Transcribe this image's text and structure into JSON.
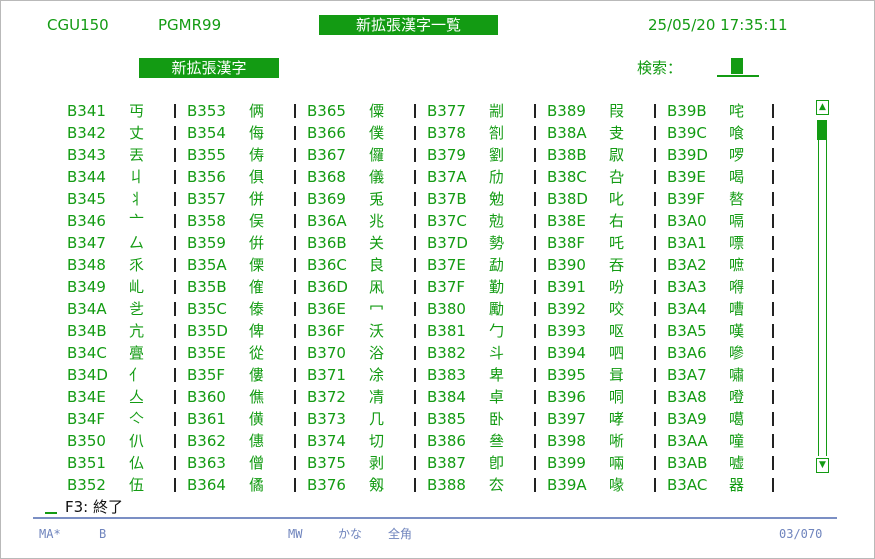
{
  "header": {
    "screen_id": "CGU150",
    "program_id": "PGMR99",
    "title": "新拡張漢字一覧",
    "datetime": "25/05/20 17:35:11"
  },
  "subheader": {
    "label": "新拡張漢字",
    "search_label": "検索："
  },
  "columns": [
    [
      [
        "B341",
        "丏"
      ],
      [
        "B342",
        "丈"
      ],
      [
        "B343",
        "丟"
      ],
      [
        "B344",
        "丩"
      ],
      [
        "B345",
        "丬"
      ],
      [
        "B346",
        "亠"
      ],
      [
        "B347",
        "厶"
      ],
      [
        "B348",
        "乑"
      ],
      [
        "B349",
        "乢"
      ],
      [
        "B34A",
        "乧"
      ],
      [
        "B34B",
        "亢"
      ],
      [
        "B34C",
        "亹"
      ],
      [
        "B34D",
        "亻"
      ],
      [
        "B34E",
        "亼"
      ],
      [
        "B34F",
        "亽"
      ],
      [
        "B350",
        "仈"
      ],
      [
        "B351",
        "仏"
      ],
      [
        "B352",
        "伍"
      ]
    ],
    [
      [
        "B353",
        "俩"
      ],
      [
        "B354",
        "侮"
      ],
      [
        "B355",
        "俦"
      ],
      [
        "B356",
        "俱"
      ],
      [
        "B357",
        "併"
      ],
      [
        "B358",
        "俣"
      ],
      [
        "B359",
        "倂"
      ],
      [
        "B35A",
        "傈"
      ],
      [
        "B35B",
        "傕"
      ],
      [
        "B35C",
        "傣"
      ],
      [
        "B35D",
        "俾"
      ],
      [
        "B35E",
        "從"
      ],
      [
        "B35F",
        "僂"
      ],
      [
        "B360",
        "僬"
      ],
      [
        "B361",
        "僙"
      ],
      [
        "B362",
        "僡"
      ],
      [
        "B363",
        "僧"
      ],
      [
        "B364",
        "僪"
      ]
    ],
    [
      [
        "B365",
        "僳"
      ],
      [
        "B366",
        "僕"
      ],
      [
        "B367",
        "儸"
      ],
      [
        "B368",
        "儀"
      ],
      [
        "B369",
        "兎"
      ],
      [
        "B36A",
        "兆"
      ],
      [
        "B36B",
        "关"
      ],
      [
        "B36C",
        "良"
      ],
      [
        "B36D",
        "凩"
      ],
      [
        "B36E",
        "冖"
      ],
      [
        "B36F",
        "沃"
      ],
      [
        "B370",
        "浴"
      ],
      [
        "B371",
        "凃"
      ],
      [
        "B372",
        "凊"
      ],
      [
        "B373",
        "几"
      ],
      [
        "B374",
        "切"
      ],
      [
        "B375",
        "剥"
      ],
      [
        "B376",
        "剱"
      ]
    ],
    [
      [
        "B377",
        "剬"
      ],
      [
        "B378",
        "劄"
      ],
      [
        "B379",
        "劉"
      ],
      [
        "B37A",
        "劤"
      ],
      [
        "B37B",
        "勉"
      ],
      [
        "B37C",
        "勊"
      ],
      [
        "B37D",
        "勢"
      ],
      [
        "B37E",
        "勐"
      ],
      [
        "B37F",
        "勤"
      ],
      [
        "B380",
        "勵"
      ],
      [
        "B381",
        "勹"
      ],
      [
        "B382",
        "斗"
      ],
      [
        "B383",
        "卑"
      ],
      [
        "B384",
        "卓"
      ],
      [
        "B385",
        "卧"
      ],
      [
        "B386",
        "叄"
      ],
      [
        "B387",
        "卽"
      ],
      [
        "B388",
        "厺"
      ]
    ],
    [
      [
        "B389",
        "叚"
      ],
      [
        "B38A",
        "叏"
      ],
      [
        "B38B",
        "叞"
      ],
      [
        "B38C",
        "叴"
      ],
      [
        "B38D",
        "叱"
      ],
      [
        "B38E",
        "右"
      ],
      [
        "B38F",
        "吒"
      ],
      [
        "B390",
        "吞"
      ],
      [
        "B391",
        "吩"
      ],
      [
        "B392",
        "咬"
      ],
      [
        "B393",
        "呕"
      ],
      [
        "B394",
        "呬"
      ],
      [
        "B395",
        "咠"
      ],
      [
        "B396",
        "哃"
      ],
      [
        "B397",
        "哮"
      ],
      [
        "B398",
        "唽"
      ],
      [
        "B399",
        "啢"
      ],
      [
        "B39A",
        "喙"
      ]
    ],
    [
      [
        "B39B",
        "咤"
      ],
      [
        "B39C",
        "喰"
      ],
      [
        "B39D",
        "啰"
      ],
      [
        "B39E",
        "喝"
      ],
      [
        "B39F",
        "嗸"
      ],
      [
        "B3A0",
        "嗝"
      ],
      [
        "B3A1",
        "嘌"
      ],
      [
        "B3A2",
        "嗻"
      ],
      [
        "B3A3",
        "嘚"
      ],
      [
        "B3A4",
        "嘈"
      ],
      [
        "B3A5",
        "嘆"
      ],
      [
        "B3A6",
        "嘇"
      ],
      [
        "B3A7",
        "嘯"
      ],
      [
        "B3A8",
        "噔"
      ],
      [
        "B3A9",
        "噶"
      ],
      [
        "B3AA",
        "噇"
      ],
      [
        "B3AB",
        "嘘"
      ],
      [
        "B3AC",
        "器"
      ]
    ]
  ],
  "scrollbar": {
    "up_glyph": "▲",
    "down_glyph": "▼"
  },
  "function_keys": {
    "key": "F3:",
    "action": "終了"
  },
  "status_bar": {
    "mode": "MA*",
    "field": "B",
    "input_mode": "MW",
    "kana": "かな",
    "width": "全角",
    "page": "03/070"
  }
}
